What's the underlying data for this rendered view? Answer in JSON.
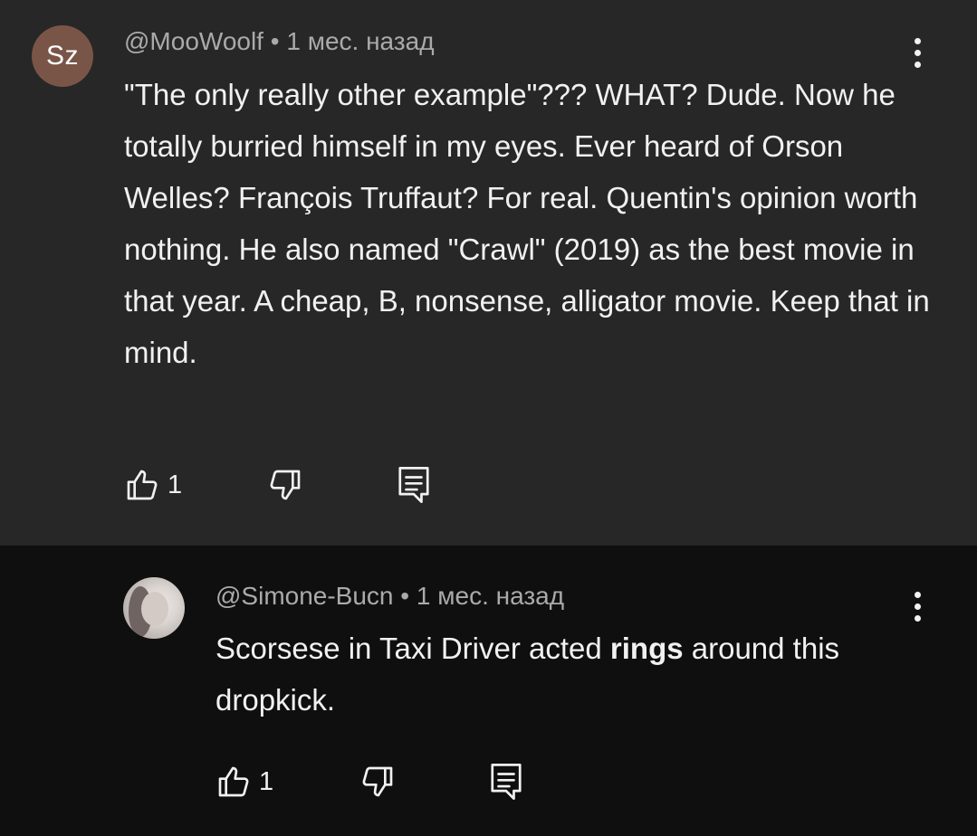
{
  "comments": [
    {
      "avatar_initials": "Sz",
      "avatar_color": "#795548",
      "author": "@MooWoolf",
      "separator": "•",
      "time": "1 мес. назад",
      "text": "\"The only really other example\"??? WHAT? Dude. Now he totally burried himself in my eyes. Ever heard of Orson Welles? François Truffaut? For real. Quentin's opinion worth nothing. He also named \"Crawl\" (2019) as the best movie in that year. A cheap, B, nonsense, alligator movie. Keep that in mind.",
      "likes": "1",
      "icons": [
        "like-icon",
        "dislike-icon",
        "reply-icon",
        "more-vertical-icon"
      ]
    },
    {
      "author": "@Simone-Bucn",
      "separator": "•",
      "time": "1 мес. назад",
      "text_before": "Scorsese in Taxi Driver acted ",
      "text_bold": "rings",
      "text_after": " around this dropkick.",
      "likes": "1",
      "icons": [
        "like-icon",
        "dislike-icon",
        "reply-icon",
        "more-vertical-icon"
      ]
    }
  ],
  "colors": {
    "top_comment_bg": "#272727",
    "reply_bg": "#0f0f0f",
    "text": "#f1f1f1",
    "meta": "#aaaaaa"
  }
}
